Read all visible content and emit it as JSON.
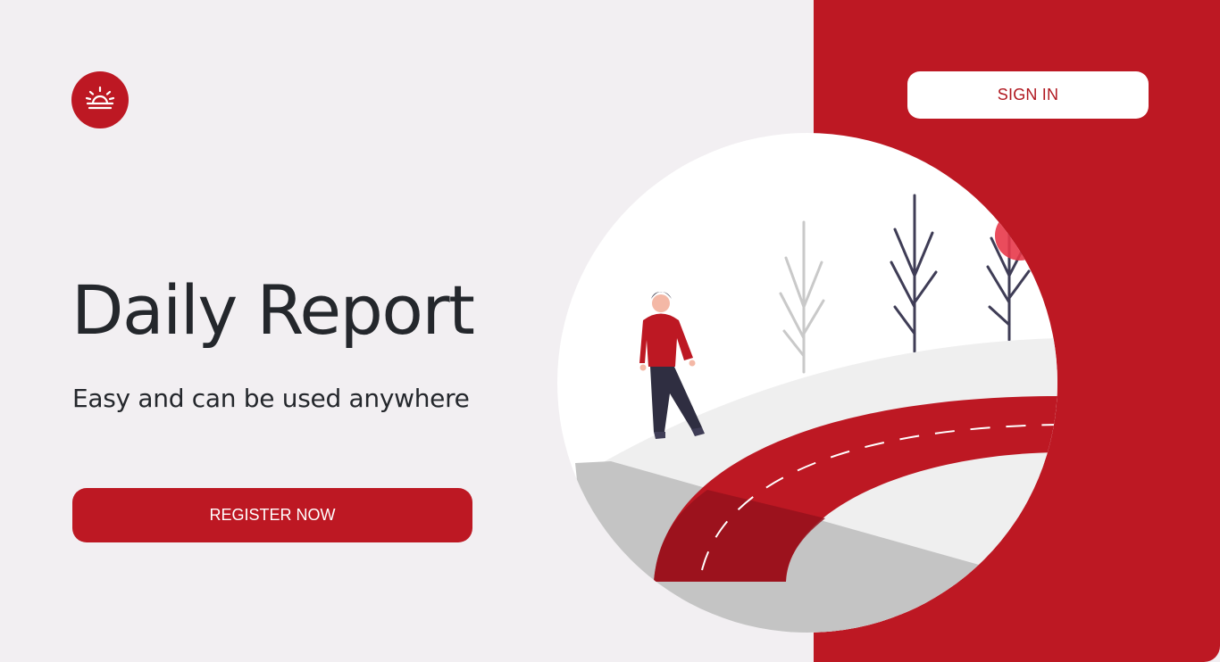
{
  "header": {
    "logo_icon": "sunrise-icon",
    "signin_label": "SIGN IN"
  },
  "hero": {
    "title": "Daily Report",
    "subtitle": "Easy and can be used anywhere",
    "register_label": "REGISTER NOW"
  },
  "illustration": {
    "subject": "person-walking-on-road-illustration"
  },
  "colors": {
    "brand_red": "#bd1823",
    "dark_red": "#96121c",
    "background": "#f2eff2",
    "text_dark": "#24272c",
    "white": "#ffffff"
  }
}
